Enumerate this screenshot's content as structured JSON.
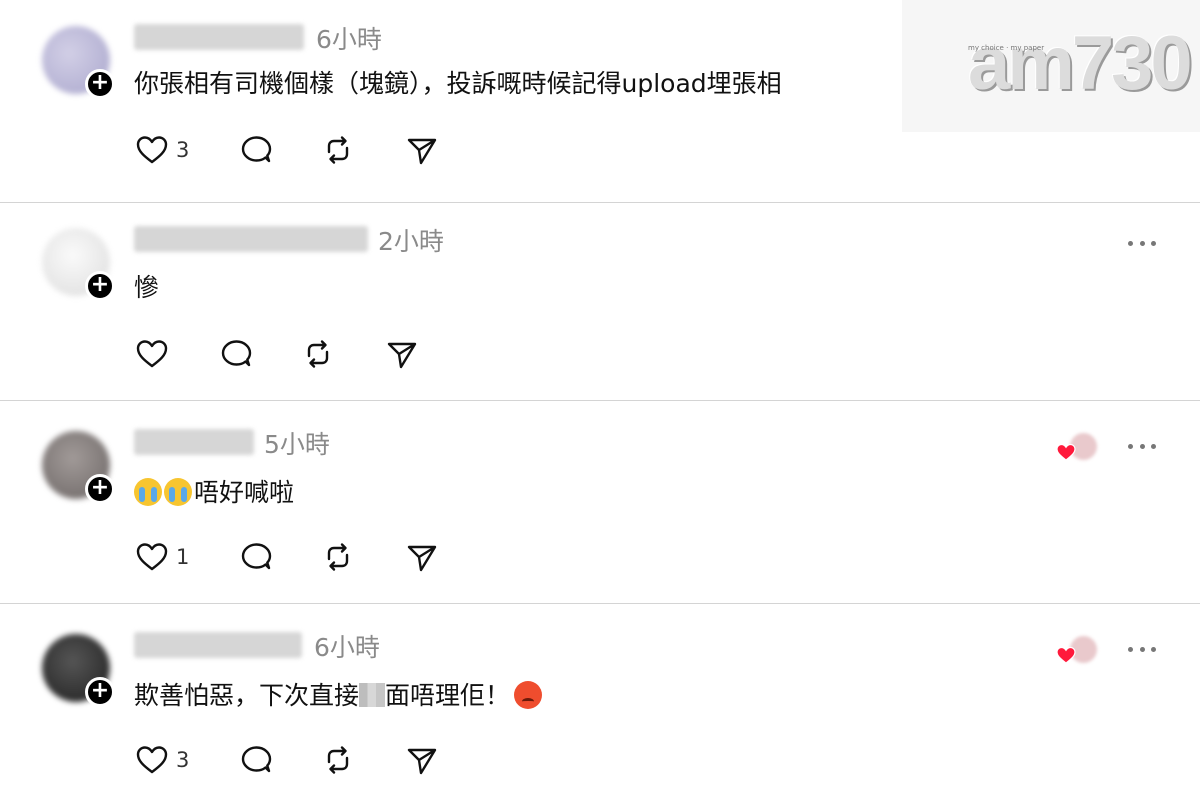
{
  "watermark": {
    "logo": "am730",
    "tagline": "my choice · my paper"
  },
  "posts": [
    {
      "time": "6小時",
      "text": "你張相有司機個樣（塊鏡），投訴嘅時候記得upload埋張相",
      "like_count": "3",
      "show_likers": false,
      "avatar_color": "#b9b7d6"
    },
    {
      "time": "2小時",
      "text": "慘",
      "like_count": "",
      "show_likers": false,
      "avatar_color": "#ececec"
    },
    {
      "time": "5小時",
      "emoji_before": [
        "loudly-crying-face",
        "loudly-crying-face"
      ],
      "text": "唔好喊啦",
      "like_count": "1",
      "show_likers": true,
      "avatar_color": "#8a8483"
    },
    {
      "time": "6小時",
      "text_before": "欺善怕惡，下次直接",
      "text_after": "面唔理佢！",
      "emoji_after": "enraged-face",
      "like_count": "3",
      "show_likers": true,
      "avatar_color": "#3a3a3a"
    }
  ],
  "colors": {
    "accent_heart": "#ff1a3c",
    "divider": "#d4d4d4",
    "muted_text": "#8a8a8a"
  },
  "icons": [
    "heart-icon",
    "comment-icon",
    "repost-icon",
    "share-icon",
    "more-icon",
    "plus-icon"
  ]
}
